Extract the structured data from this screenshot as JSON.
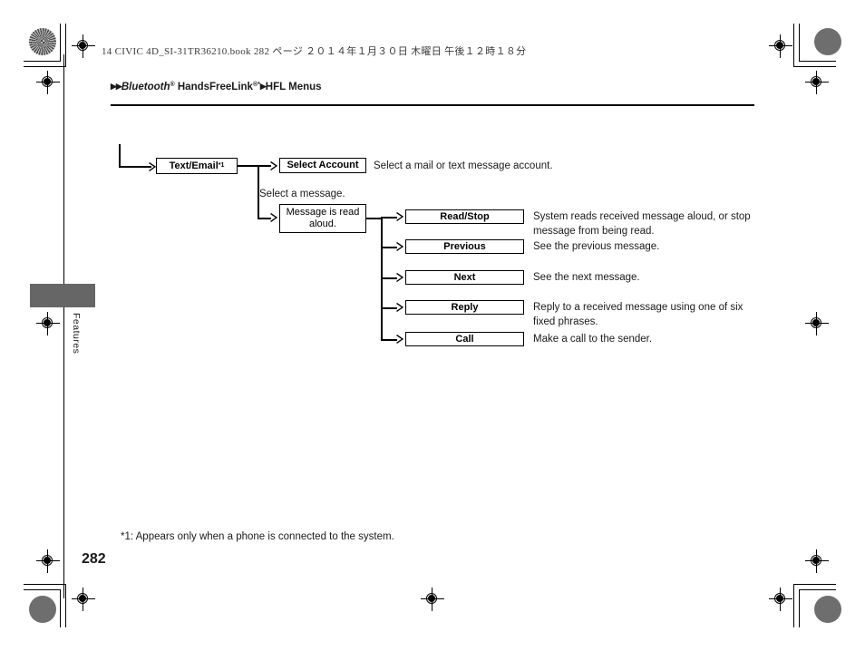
{
  "page": {
    "slug": "14 CIVIC 4D_SI-31TR36210.book   282 ページ   ２０１４年１月３０日   木曜日   午後１２時１８分",
    "page_number": "282",
    "side_tab_label": "Features",
    "footnote": "*1: Appears only when a phone is connected to the system."
  },
  "breadcrumb": {
    "arrow_double": "▶▶",
    "arrow_single": "▶",
    "item1_main": "Bluetooth",
    "item1_reg": "®",
    "item2_main": "HandsFreeLink",
    "item2_reg": "®",
    "item2_footnote": "*",
    "item3": "HFL Menus"
  },
  "flow": {
    "root": {
      "label": "Text/Email",
      "footnote": "*1"
    },
    "branch_account": {
      "label": "Select Account",
      "description": "Select a mail or text message account."
    },
    "branch_message": {
      "caption": "Select a message.",
      "label_line1": "Message is read",
      "label_line2": "aloud."
    },
    "actions": [
      {
        "label": "Read/Stop",
        "description_line1": "System reads received message aloud, or stop",
        "description_line2": "message from being read."
      },
      {
        "label": "Previous",
        "description_line1": "See the previous message.",
        "description_line2": ""
      },
      {
        "label": "Next",
        "description_line1": "See the next message.",
        "description_line2": ""
      },
      {
        "label": "Reply",
        "description_line1": "Reply to a received message using one of six",
        "description_line2": "fixed phrases."
      },
      {
        "label": "Call",
        "description_line1": "Make a call to the sender.",
        "description_line2": ""
      }
    ]
  },
  "colors": {
    "side_tab": "#666666",
    "text": "#1a1a1a",
    "line": "#000000",
    "crop_blob": "#6e6e6e"
  }
}
